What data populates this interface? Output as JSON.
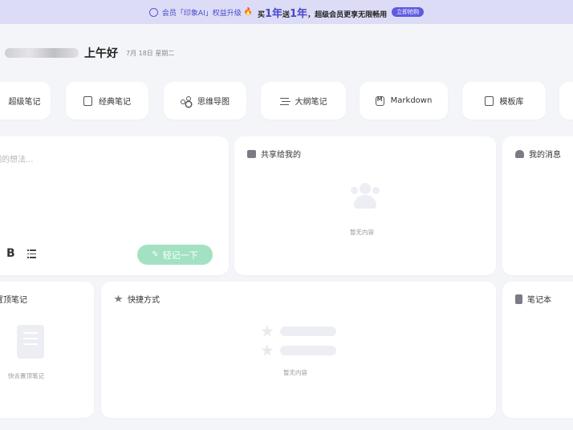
{
  "banner": {
    "text": "会员「印象AI」权益升级",
    "flame": "🔥",
    "promo_prefix": "买",
    "promo_year1": "1年",
    "promo_mid": "送",
    "promo_year2": "1年",
    "promo_suffix": "，超级会员更享无限畅用",
    "button": "立即抢购"
  },
  "greeting": {
    "hello": "上午好",
    "date": "7月 18日 星期二"
  },
  "quick_actions": [
    {
      "label": "超级笔记",
      "icon": "super-note-icon"
    },
    {
      "label": "经典笔记",
      "icon": "classic-note-icon"
    },
    {
      "label": "思维导图",
      "icon": "mind-map-icon"
    },
    {
      "label": "大纲笔记",
      "icon": "outline-note-icon"
    },
    {
      "label": "Markdown",
      "icon": "markdown-icon"
    },
    {
      "label": "模板库",
      "icon": "template-library-icon"
    }
  ],
  "quick_note": {
    "placeholder": "此刻的想法...",
    "bold": "B",
    "submit": "轻记一下"
  },
  "shared": {
    "title": "共享给我的",
    "empty": "暂无内容"
  },
  "messages": {
    "title": "我的消息"
  },
  "pinned": {
    "title": "置顶笔记",
    "empty": "快去置顶笔记"
  },
  "shortcuts": {
    "title": "快捷方式",
    "empty": "暂无内容"
  },
  "notebooks": {
    "title": "笔记本"
  }
}
